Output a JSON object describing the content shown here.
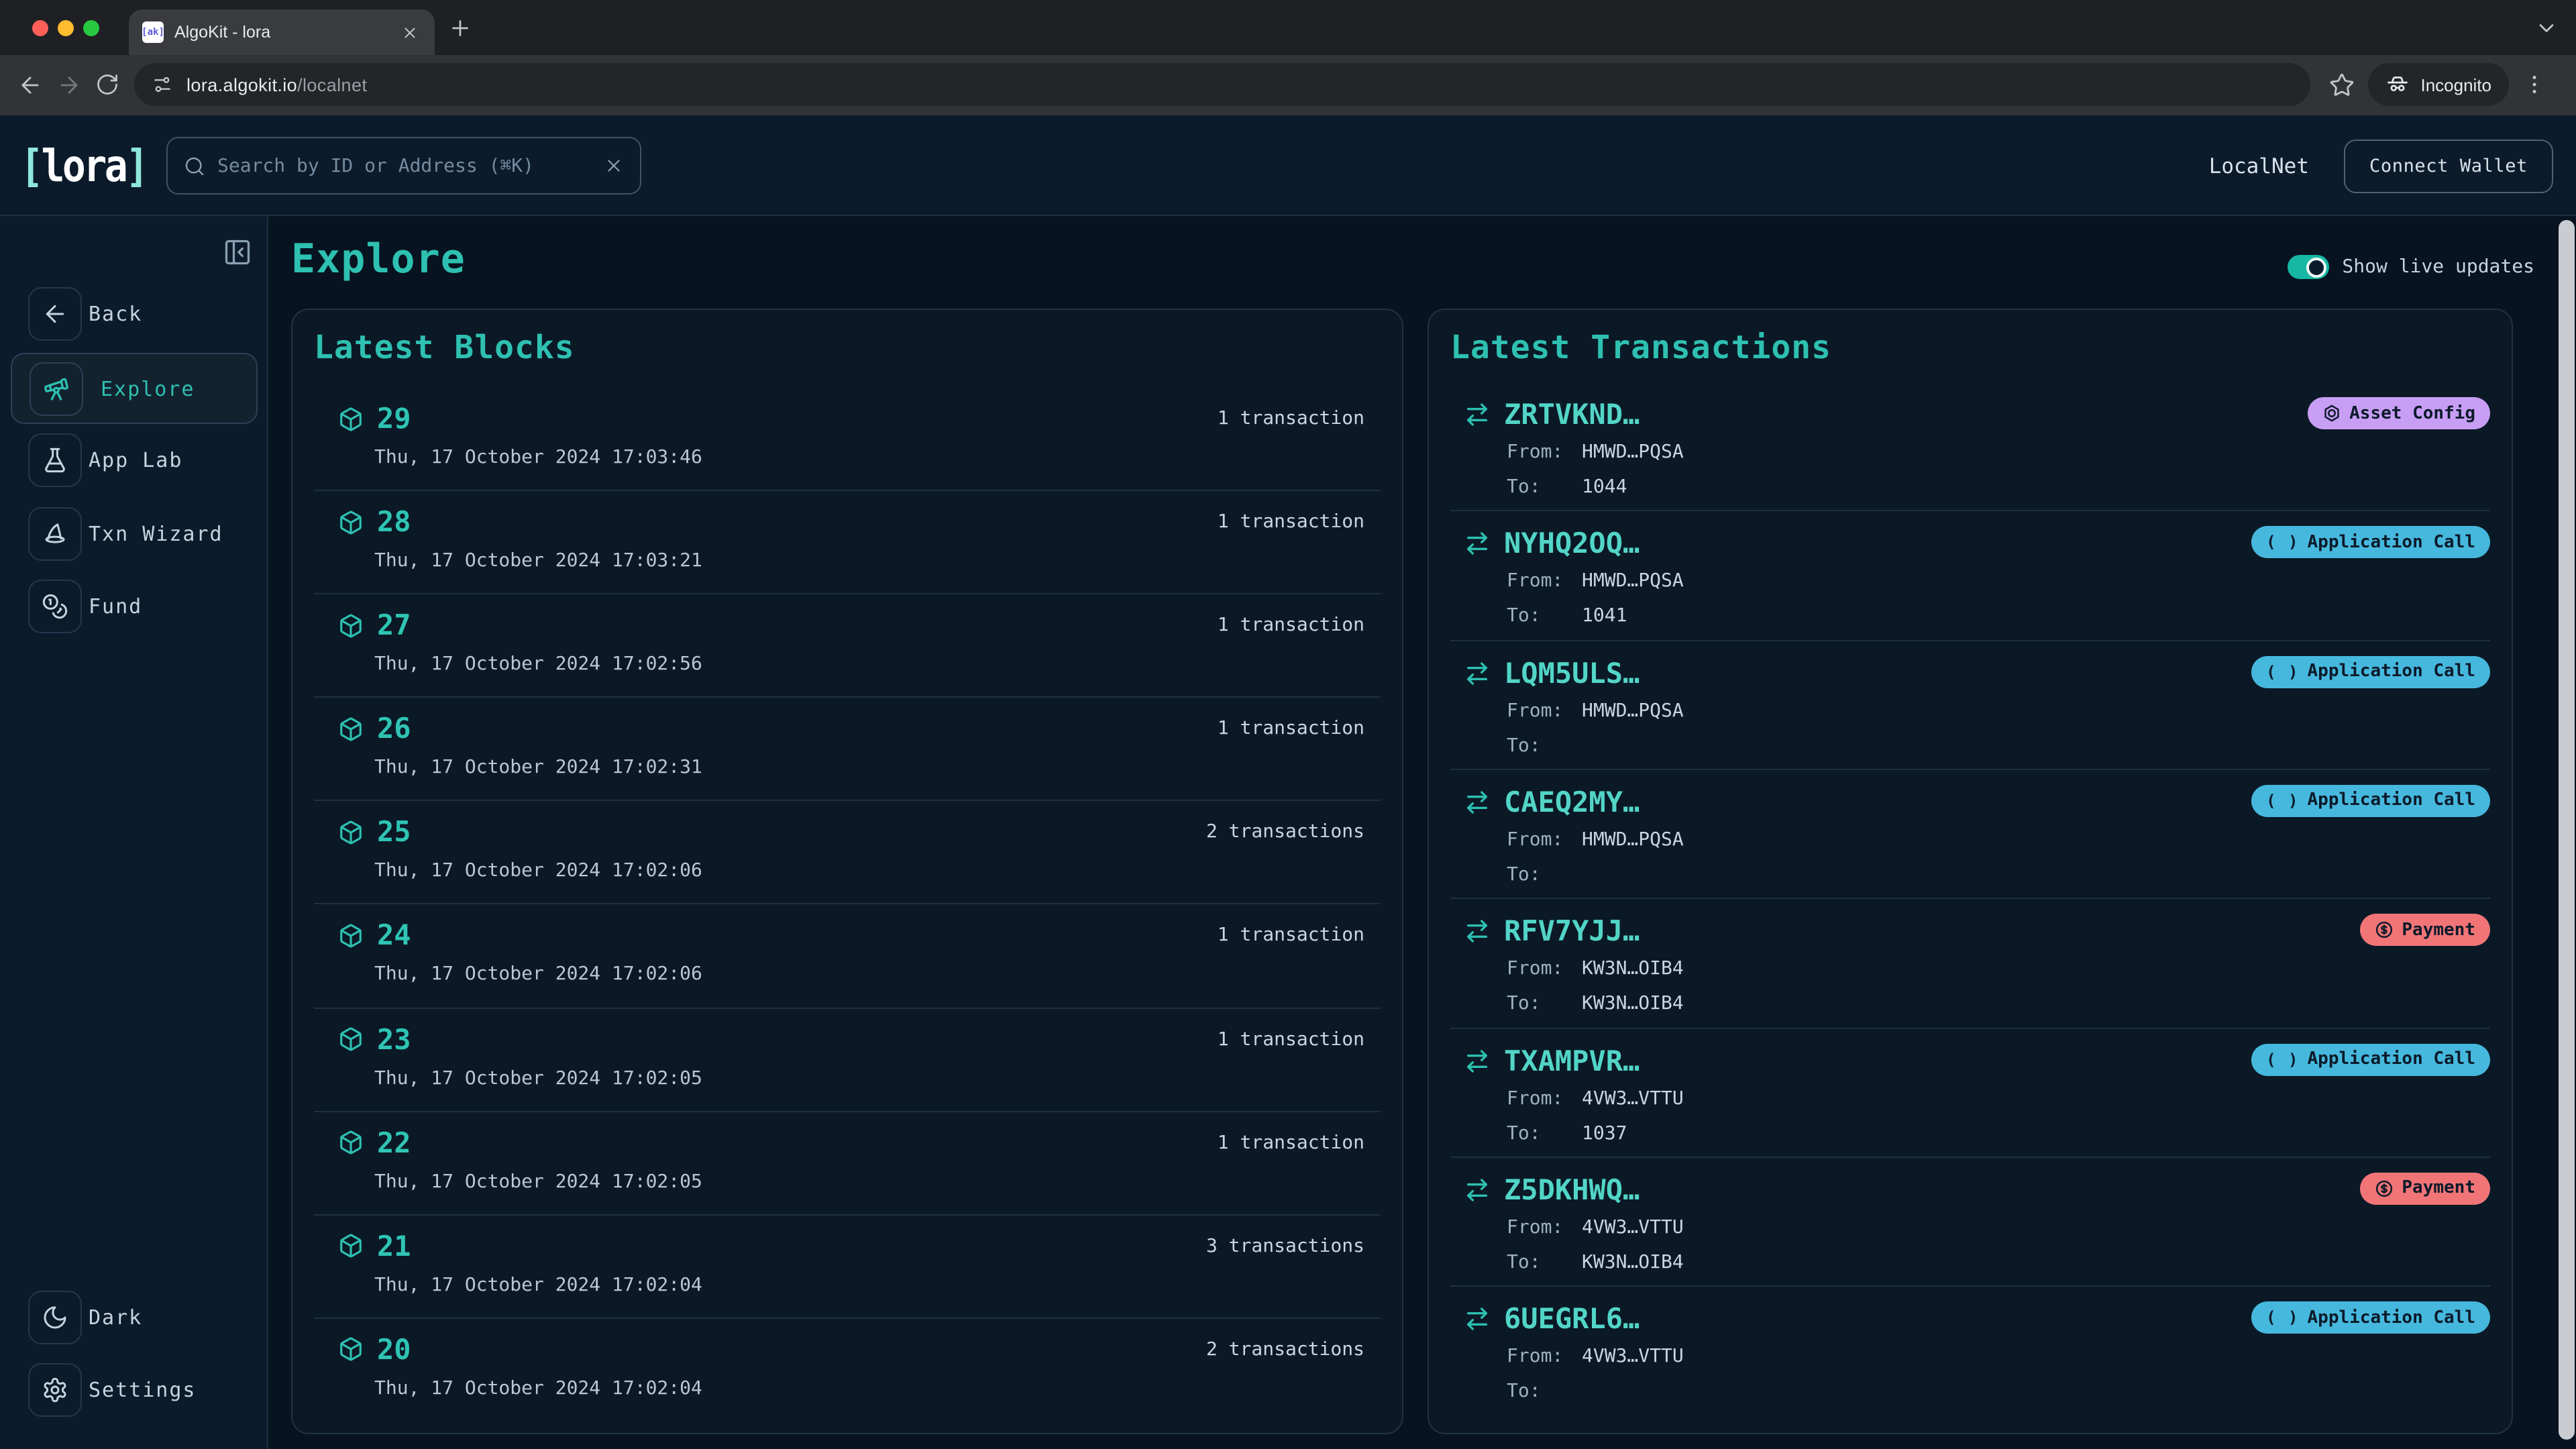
{
  "browser": {
    "tab_title": "AlgoKit - lora",
    "favicon_text": "[ak]",
    "url_domain": "lora.algokit.io",
    "url_path": "/localnet",
    "incognito_label": "Incognito"
  },
  "header": {
    "logo_bracket_open": "[",
    "logo_name": "lora",
    "logo_bracket_close": "]",
    "search_placeholder": "Search by ID or Address (⌘K)",
    "network_label": "LocalNet",
    "connect_wallet_label": "Connect Wallet"
  },
  "sidebar": {
    "back_label": "Back",
    "items": [
      {
        "label": "Explore",
        "active": true
      },
      {
        "label": "App Lab",
        "active": false
      },
      {
        "label": "Txn Wizard",
        "active": false
      },
      {
        "label": "Fund",
        "active": false
      }
    ],
    "theme_label": "Dark",
    "settings_label": "Settings"
  },
  "page": {
    "title": "Explore",
    "live_updates_label": "Show live updates",
    "live_updates_on": true
  },
  "blocks_panel": {
    "title": "Latest Blocks",
    "rows": [
      {
        "number": "29",
        "timestamp": "Thu, 17 October 2024 17:03:46",
        "txn_count": "1 transaction"
      },
      {
        "number": "28",
        "timestamp": "Thu, 17 October 2024 17:03:21",
        "txn_count": "1 transaction"
      },
      {
        "number": "27",
        "timestamp": "Thu, 17 October 2024 17:02:56",
        "txn_count": "1 transaction"
      },
      {
        "number": "26",
        "timestamp": "Thu, 17 October 2024 17:02:31",
        "txn_count": "1 transaction"
      },
      {
        "number": "25",
        "timestamp": "Thu, 17 October 2024 17:02:06",
        "txn_count": "2 transactions"
      },
      {
        "number": "24",
        "timestamp": "Thu, 17 October 2024 17:02:06",
        "txn_count": "1 transaction"
      },
      {
        "number": "23",
        "timestamp": "Thu, 17 October 2024 17:02:05",
        "txn_count": "1 transaction"
      },
      {
        "number": "22",
        "timestamp": "Thu, 17 October 2024 17:02:05",
        "txn_count": "1 transaction"
      },
      {
        "number": "21",
        "timestamp": "Thu, 17 October 2024 17:02:04",
        "txn_count": "3 transactions"
      },
      {
        "number": "20",
        "timestamp": "Thu, 17 October 2024 17:02:04",
        "txn_count": "2 transactions"
      }
    ]
  },
  "transactions_panel": {
    "title": "Latest Transactions",
    "from_label": "From:",
    "to_label": "To:",
    "rows": [
      {
        "id": "ZRTVKND…",
        "type_key": "asset_config",
        "type_label": "Asset Config",
        "from": "HMWD…PQSA",
        "to": "1044"
      },
      {
        "id": "NYHQ2OQ…",
        "type_key": "application_call",
        "type_label": "Application Call",
        "from": "HMWD…PQSA",
        "to": "1041"
      },
      {
        "id": "LQM5ULS…",
        "type_key": "application_call",
        "type_label": "Application Call",
        "from": "HMWD…PQSA",
        "to": ""
      },
      {
        "id": "CAEQ2MY…",
        "type_key": "application_call",
        "type_label": "Application Call",
        "from": "HMWD…PQSA",
        "to": ""
      },
      {
        "id": "RFV7YJJ…",
        "type_key": "payment",
        "type_label": "Payment",
        "from": "KW3N…OIB4",
        "to": "KW3N…OIB4"
      },
      {
        "id": "TXAMPVR…",
        "type_key": "application_call",
        "type_label": "Application Call",
        "from": "4VW3…VTTU",
        "to": "1037"
      },
      {
        "id": "Z5DKHWQ…",
        "type_key": "payment",
        "type_label": "Payment",
        "from": "4VW3…VTTU",
        "to": "KW3N…OIB4"
      },
      {
        "id": "6UEGRL6…",
        "type_key": "application_call",
        "type_label": "Application Call",
        "from": "4VW3…VTTU",
        "to": ""
      }
    ]
  },
  "colors": {
    "accent_teal": "#2ec0b1",
    "badge_text": "#0c1a2a",
    "badges": {
      "asset_config": "#c89ef5",
      "application_call": "#46b8dd",
      "payment": "#f17577"
    }
  }
}
